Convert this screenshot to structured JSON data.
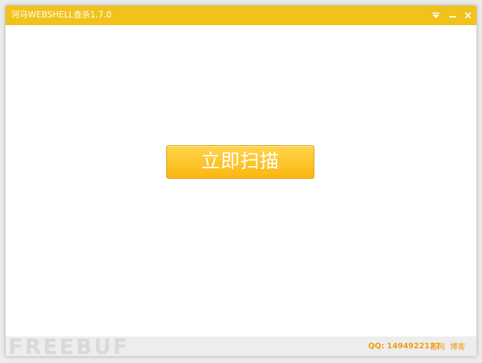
{
  "window": {
    "title": "河马WEBSHELL查杀1.7.0"
  },
  "controls": {
    "dropdown_icon": "chevron-down-bar-icon",
    "minimize_icon": "minimize-icon",
    "close_icon": "close-icon"
  },
  "main": {
    "scan_button_label": "立即扫描"
  },
  "footer": {
    "qq": "QQ: 1494922137",
    "links": [
      "官网",
      "博客"
    ],
    "watermark": "FREEBUF"
  },
  "colors": {
    "titlebar": "#f1c21b",
    "button_top": "#ffd44d",
    "button_bottom": "#fbb710",
    "footer_text": "#f59b14"
  }
}
